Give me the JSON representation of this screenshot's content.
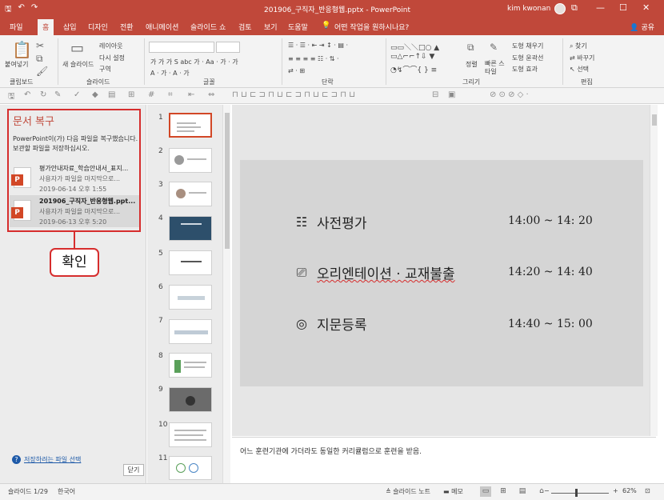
{
  "window": {
    "title": "201906_구직자_반응형웹.pptx - PowerPoint",
    "user": "kim kwonan",
    "controls": [
      "⧉",
      "—",
      "☐",
      "✕"
    ]
  },
  "tabs": [
    "파일",
    "홈",
    "삽입",
    "디자인",
    "전환",
    "애니메이션",
    "슬라이드 쇼",
    "검토",
    "보기",
    "도움말"
  ],
  "tell_me": "어떤 작업을 원하시나요?",
  "share": "공유",
  "ribbon": {
    "paste": "붙여넣기",
    "new_slide": "새 슬라이드",
    "layout": "레이아웃",
    "reset": "다시 설정",
    "section": "구역",
    "groups": [
      "클립보드",
      "슬라이드",
      "글꼴",
      "단락",
      "그리기",
      "편집"
    ],
    "arrange": "정렬",
    "quick_styles": "빠른 스타일",
    "shape_fill": "도형 채우기",
    "shape_outline": "도형 윤곽선",
    "shape_effects": "도형 효과",
    "find": "찾기",
    "replace": "바꾸기",
    "select": "선택"
  },
  "recovery": {
    "title": "문서 복구",
    "description": "PowerPoint이(가) 다음 파일을 복구했습니다. 보관할 파일을 저장하십시오.",
    "files": [
      {
        "name": "평가안내자료_학습안내서_표지...",
        "sub": "사용자가 파일을 마지막으로...",
        "date": "2019-06-14 오후 1:55"
      },
      {
        "name": "201906_구직자_반응형웹.ppt...",
        "sub": "사용자가 파일을 마지막으로...",
        "date": "2019-06-13 오후 5:20"
      }
    ],
    "link": "저장하려는 파일 선택",
    "close": "닫기",
    "callout": "확인"
  },
  "thumbnails": [
    "1",
    "2",
    "3",
    "4",
    "5",
    "6",
    "7",
    "8",
    "9",
    "10",
    "11"
  ],
  "slide": {
    "items": [
      {
        "label": "사전평가",
        "time": "14:00 ~ 14: 20",
        "icon": "checklist-icon"
      },
      {
        "label": "오리엔테이션 · 교재불출",
        "time": "14:20 ~ 14: 40",
        "icon": "presentation-icon"
      },
      {
        "label": "지문등록",
        "time": "14:40 ~ 15: 00",
        "icon": "fingerprint-icon"
      }
    ]
  },
  "notes": "어느 훈련기관에 가더라도 동일한 커리큘럼으로 훈련을 받음.",
  "status": {
    "slide_count": "슬라이드 1/29",
    "language": "한국어",
    "slide_notes": "슬라이드 노트",
    "comments": "메모",
    "zoom": "62%",
    "zoom_value": 0.62
  }
}
